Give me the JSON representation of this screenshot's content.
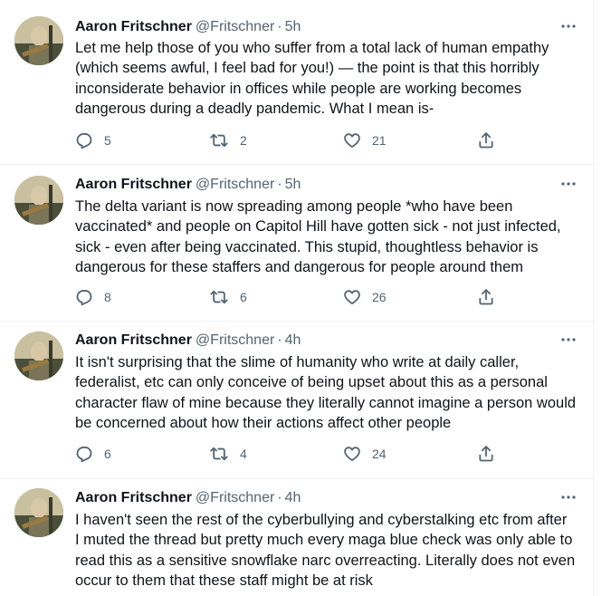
{
  "tweets": [
    {
      "author": "Aaron Fritschner",
      "handle": "@Fritschner",
      "separator": "·",
      "time": "5h",
      "text": "Let me help those of you who suffer from a total lack of human empathy\n(which seems awful, I feel bad for you!) — the point is that this horribly\ninconsiderate behavior in offices while people are working becomes\ndangerous during a deadly pandemic. What I mean is-",
      "replies": "5",
      "retweets": "2",
      "likes": "21"
    },
    {
      "author": "Aaron Fritschner",
      "handle": "@Fritschner",
      "separator": "·",
      "time": "5h",
      "text": "The delta variant is now spreading among people *who have been\nvaccinated* and people on Capitol Hill have gotten sick - not just infected,\nsick - even after being vaccinated. This stupid, thoughtless behavior is\ndangerous for these staffers and dangerous for people around them",
      "replies": "8",
      "retweets": "6",
      "likes": "26"
    },
    {
      "author": "Aaron Fritschner",
      "handle": "@Fritschner",
      "separator": "·",
      "time": "4h",
      "text": "It isn't surprising that the slime of humanity who write at daily caller,\nfederalist, etc can only conceive of being upset about this as a personal\ncharacter flaw of mine because they literally cannot imagine a person would\nbe concerned about how their actions affect other people",
      "replies": "6",
      "retweets": "4",
      "likes": "24"
    },
    {
      "author": "Aaron Fritschner",
      "handle": "@Fritschner",
      "separator": "·",
      "time": "4h",
      "text": "I haven't seen the rest of the cyberbullying  and cyberstalking etc from after\nI muted the thread but pretty much every maga blue check was only able to\nread this as a sensitive snowflake narc overreacting. Literally does not even\noccur to them that these staff might be at risk"
    }
  ],
  "icons": {
    "reply": "reply-icon",
    "retweet": "retweet-icon",
    "like": "heart-icon",
    "share": "share-icon",
    "more": "more-dots-icon"
  },
  "colors": {
    "text": "#0f1419",
    "secondary": "#536471",
    "divider": "#eff3f4"
  }
}
